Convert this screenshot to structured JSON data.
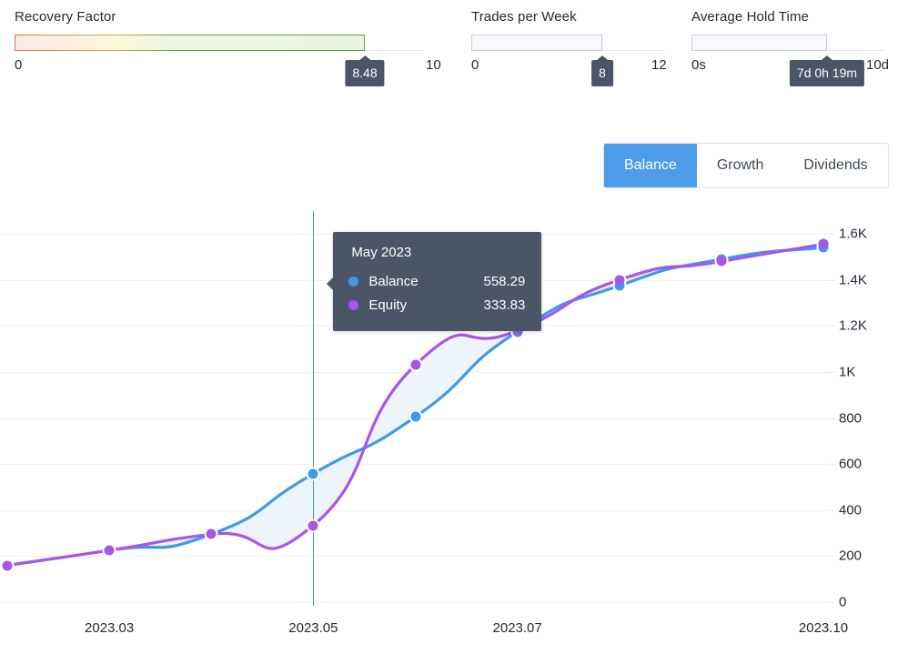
{
  "gauges": [
    {
      "title": "Recovery Factor",
      "min_label": "0",
      "max_label": "10",
      "value_label": "8.48",
      "value": 8.48,
      "max": 10,
      "style": "gradient"
    },
    {
      "title": "Trades per Week",
      "min_label": "0",
      "max_label": "12",
      "value_label": "8",
      "value": 8,
      "max": 12,
      "style": "plain"
    },
    {
      "title": "Average Hold Time",
      "min_label": "0s",
      "max_label": "10d",
      "value_label": "7d 0h 19m",
      "value": 7.013,
      "max": 10,
      "style": "plain"
    }
  ],
  "tabs": [
    {
      "label": "Balance",
      "active": true
    },
    {
      "label": "Growth",
      "active": false
    },
    {
      "label": "Dividends",
      "active": false
    }
  ],
  "tooltip": {
    "title": "May 2023",
    "rows": [
      {
        "name": "Balance",
        "value": "558.29",
        "color": "#3d9ae8"
      },
      {
        "name": "Equity",
        "value": "333.83",
        "color": "#a855e8"
      }
    ]
  },
  "colors": {
    "balance": "#3d9ae8",
    "equity": "#a855e8",
    "area_fill": "#edf4fc",
    "tab_active": "#4e9bea",
    "tooltip_bg": "#4b5565",
    "crosshair": "#3f9ac4",
    "grid": "#f0f0f2"
  },
  "chart_data": {
    "type": "line",
    "title": "",
    "xlabel": "",
    "ylabel": "",
    "grid": true,
    "legend": "none",
    "x": [
      "2023.02",
      "2023.03",
      "2023.04",
      "2023.05",
      "2023.06",
      "2023.07",
      "2023.08",
      "2023.09",
      "2023.10"
    ],
    "xtick_labels": [
      "2023.03",
      "2023.05",
      "2023.07",
      "2023.10"
    ],
    "ytick_labels": [
      "0",
      "200",
      "400",
      "600",
      "800",
      "1K",
      "1.2K",
      "1.4K",
      "1.6K"
    ],
    "ytick_values": [
      0,
      200,
      400,
      600,
      800,
      1000,
      1200,
      1400,
      1600
    ],
    "ylim": [
      0,
      1620
    ],
    "highlight_x": "2023.05",
    "series": [
      {
        "name": "Balance",
        "color": "#3d9ae8",
        "values": [
          160,
          225,
          295,
          558.29,
          805,
          1175,
          1375,
          1490,
          1540
        ]
      },
      {
        "name": "Equity",
        "color": "#a855e8",
        "values": [
          160,
          225,
          295,
          333.83,
          1030,
          1180,
          1400,
          1480,
          1555
        ]
      }
    ]
  }
}
